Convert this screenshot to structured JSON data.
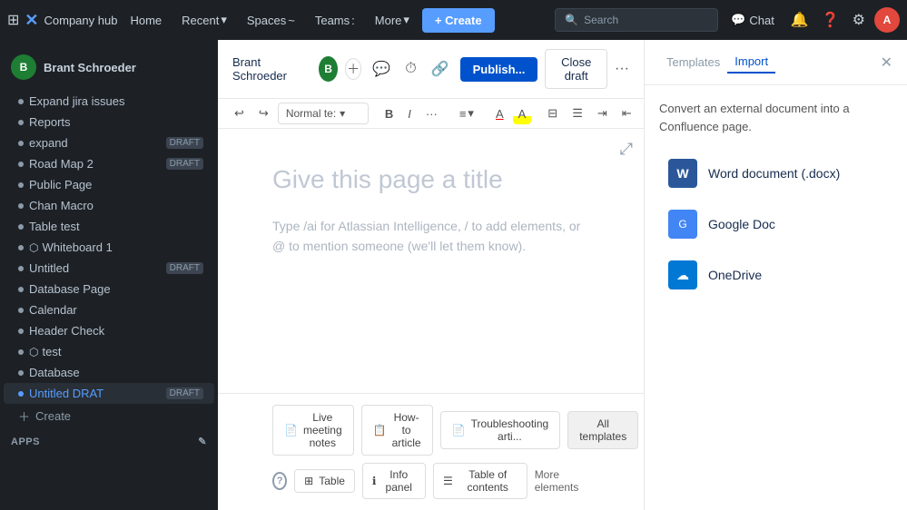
{
  "topnav": {
    "company": "Company hub",
    "home": "Home",
    "recent": "Recent",
    "spaces": "Spaces",
    "teams": "Teams",
    "more": "More",
    "create_label": "+ Create",
    "search_placeholder": "Search",
    "chat_label": "Chat"
  },
  "sidebar": {
    "user_name": "Brant Schroeder",
    "user_initials": "B",
    "items": [
      {
        "label": "Expand jira issues",
        "draft": false,
        "active": false,
        "type": "bullet"
      },
      {
        "label": "Reports",
        "draft": false,
        "active": false,
        "type": "bullet"
      },
      {
        "label": "expand",
        "draft": true,
        "draft_label": "DRAFT",
        "active": false,
        "type": "bullet"
      },
      {
        "label": "Road Map 2",
        "draft": true,
        "draft_label": "DRAFT",
        "active": false,
        "type": "bullet"
      },
      {
        "label": "Public Page",
        "draft": false,
        "active": false,
        "type": "bullet"
      },
      {
        "label": "Chart Macro",
        "draft": false,
        "active": false,
        "type": "bullet"
      },
      {
        "label": "Table test",
        "draft": false,
        "active": false,
        "type": "bullet"
      },
      {
        "label": "Whiteboard 1",
        "draft": false,
        "active": false,
        "type": "whiteboard"
      },
      {
        "label": "Untitled",
        "draft": true,
        "draft_label": "DRAFT",
        "active": false,
        "type": "bullet"
      },
      {
        "label": "Database Page",
        "draft": false,
        "active": false,
        "type": "bullet"
      },
      {
        "label": "Calendar",
        "draft": false,
        "active": false,
        "type": "bullet"
      },
      {
        "label": "Header Check",
        "draft": false,
        "active": false,
        "type": "bullet"
      },
      {
        "label": "test",
        "draft": false,
        "active": false,
        "type": "whiteboard"
      },
      {
        "label": "Database",
        "draft": false,
        "active": false,
        "type": "bullet"
      },
      {
        "label": "Untitled",
        "draft": true,
        "draft_label": "DRAFT",
        "active": true,
        "type": "bullet"
      }
    ],
    "create_label": "Create",
    "apps_label": "APPS"
  },
  "doc": {
    "author": "Brant Schroeder",
    "author_initials": "B",
    "title_placeholder": "Give this page a title",
    "content_placeholder": "Type /ai for Atlassian Intelligence, / to add elements, or @ to mention someone (we'll let them know).",
    "publish_label": "Publish...",
    "close_draft_label": "Close draft"
  },
  "toolbar": {
    "text_style": "Normal te:",
    "undo": "↩",
    "redo": "↪",
    "bold": "B",
    "italic": "I",
    "more_text": "···",
    "align": "≡",
    "color_a": "A",
    "highlight": "A",
    "bullet_list": "☰",
    "numbered": "☰",
    "indent": "☰",
    "outdent": "☰",
    "checkbox": "☐",
    "link": "🔗",
    "mention": "@",
    "emoji": "☺",
    "table": "⊞",
    "more": "···",
    "search": "🔍",
    "expand": "⤢"
  },
  "templates": {
    "live_meeting_label": "Live meeting notes",
    "how_to_label": "How-to article",
    "troubleshooting_label": "Troubleshooting arti...",
    "all_templates_label": "All templates",
    "table_label": "Table",
    "info_panel_label": "Info panel",
    "table_of_contents_label": "Table of contents",
    "more_elements_label": "More elements"
  },
  "panel": {
    "templates_tab": "Templates",
    "import_tab": "Import",
    "description": "Convert an external document into a Confluence page.",
    "options": [
      {
        "label": "Word document (.docx)",
        "icon_type": "word"
      },
      {
        "label": "Google Doc",
        "icon_type": "gdoc"
      },
      {
        "label": "OneDrive",
        "icon_type": "onedrive"
      }
    ]
  }
}
